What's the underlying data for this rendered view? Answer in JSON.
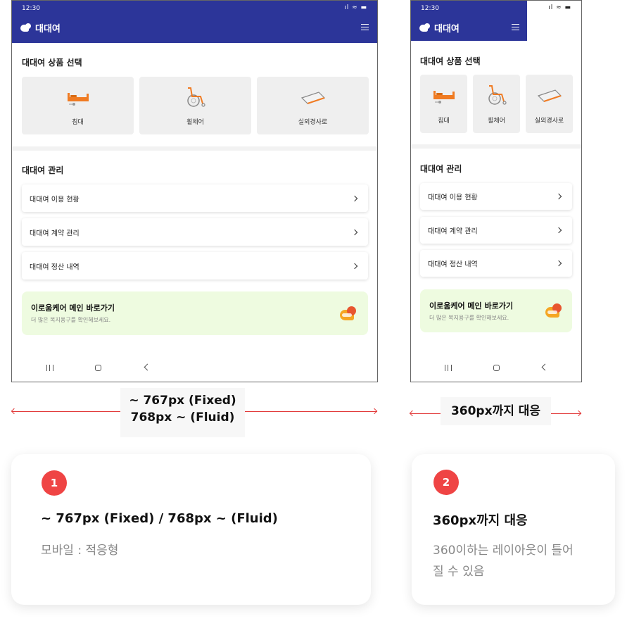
{
  "phone": {
    "status_time": "12:30",
    "status_icons": "ıl ≈ ▬",
    "brand": "대대여",
    "product_section_title": "대대여 상품 선택",
    "products": [
      {
        "label": "침대",
        "icon": "bed-icon"
      },
      {
        "label": "휠체어",
        "icon": "wheelchair-icon"
      },
      {
        "label": "실외경사로",
        "icon": "ramp-icon"
      }
    ],
    "manage_section_title": "대대여 관리",
    "menu": [
      {
        "label": "대대여 이용 현황"
      },
      {
        "label": "대대여 계약 관리"
      },
      {
        "label": "대대여 정산 내역"
      }
    ],
    "banner": {
      "title": "이로움케어 메인 바로가기",
      "subtitle": "더 많은 복지용구를 확인해보세요."
    }
  },
  "annotations": {
    "fixed_fluid_line1": "~ 767px (Fixed)",
    "fixed_fluid_line2": "768px ~ (Fluid)",
    "min_width": "360px까지 대응"
  },
  "cards": [
    {
      "number": "1",
      "title": "~ 767px (Fixed) / 768px ~ (Fluid)",
      "desc": "모바일 : 적응형"
    },
    {
      "number": "2",
      "title": "360px까지 대응",
      "desc": "360이하는 레이아웃이 틀어질 수 있음"
    }
  ],
  "colors": {
    "header": "#2c3599",
    "accent": "#ef4444",
    "banner_bg": "#eefbe0",
    "tile_bg": "#efefef"
  }
}
